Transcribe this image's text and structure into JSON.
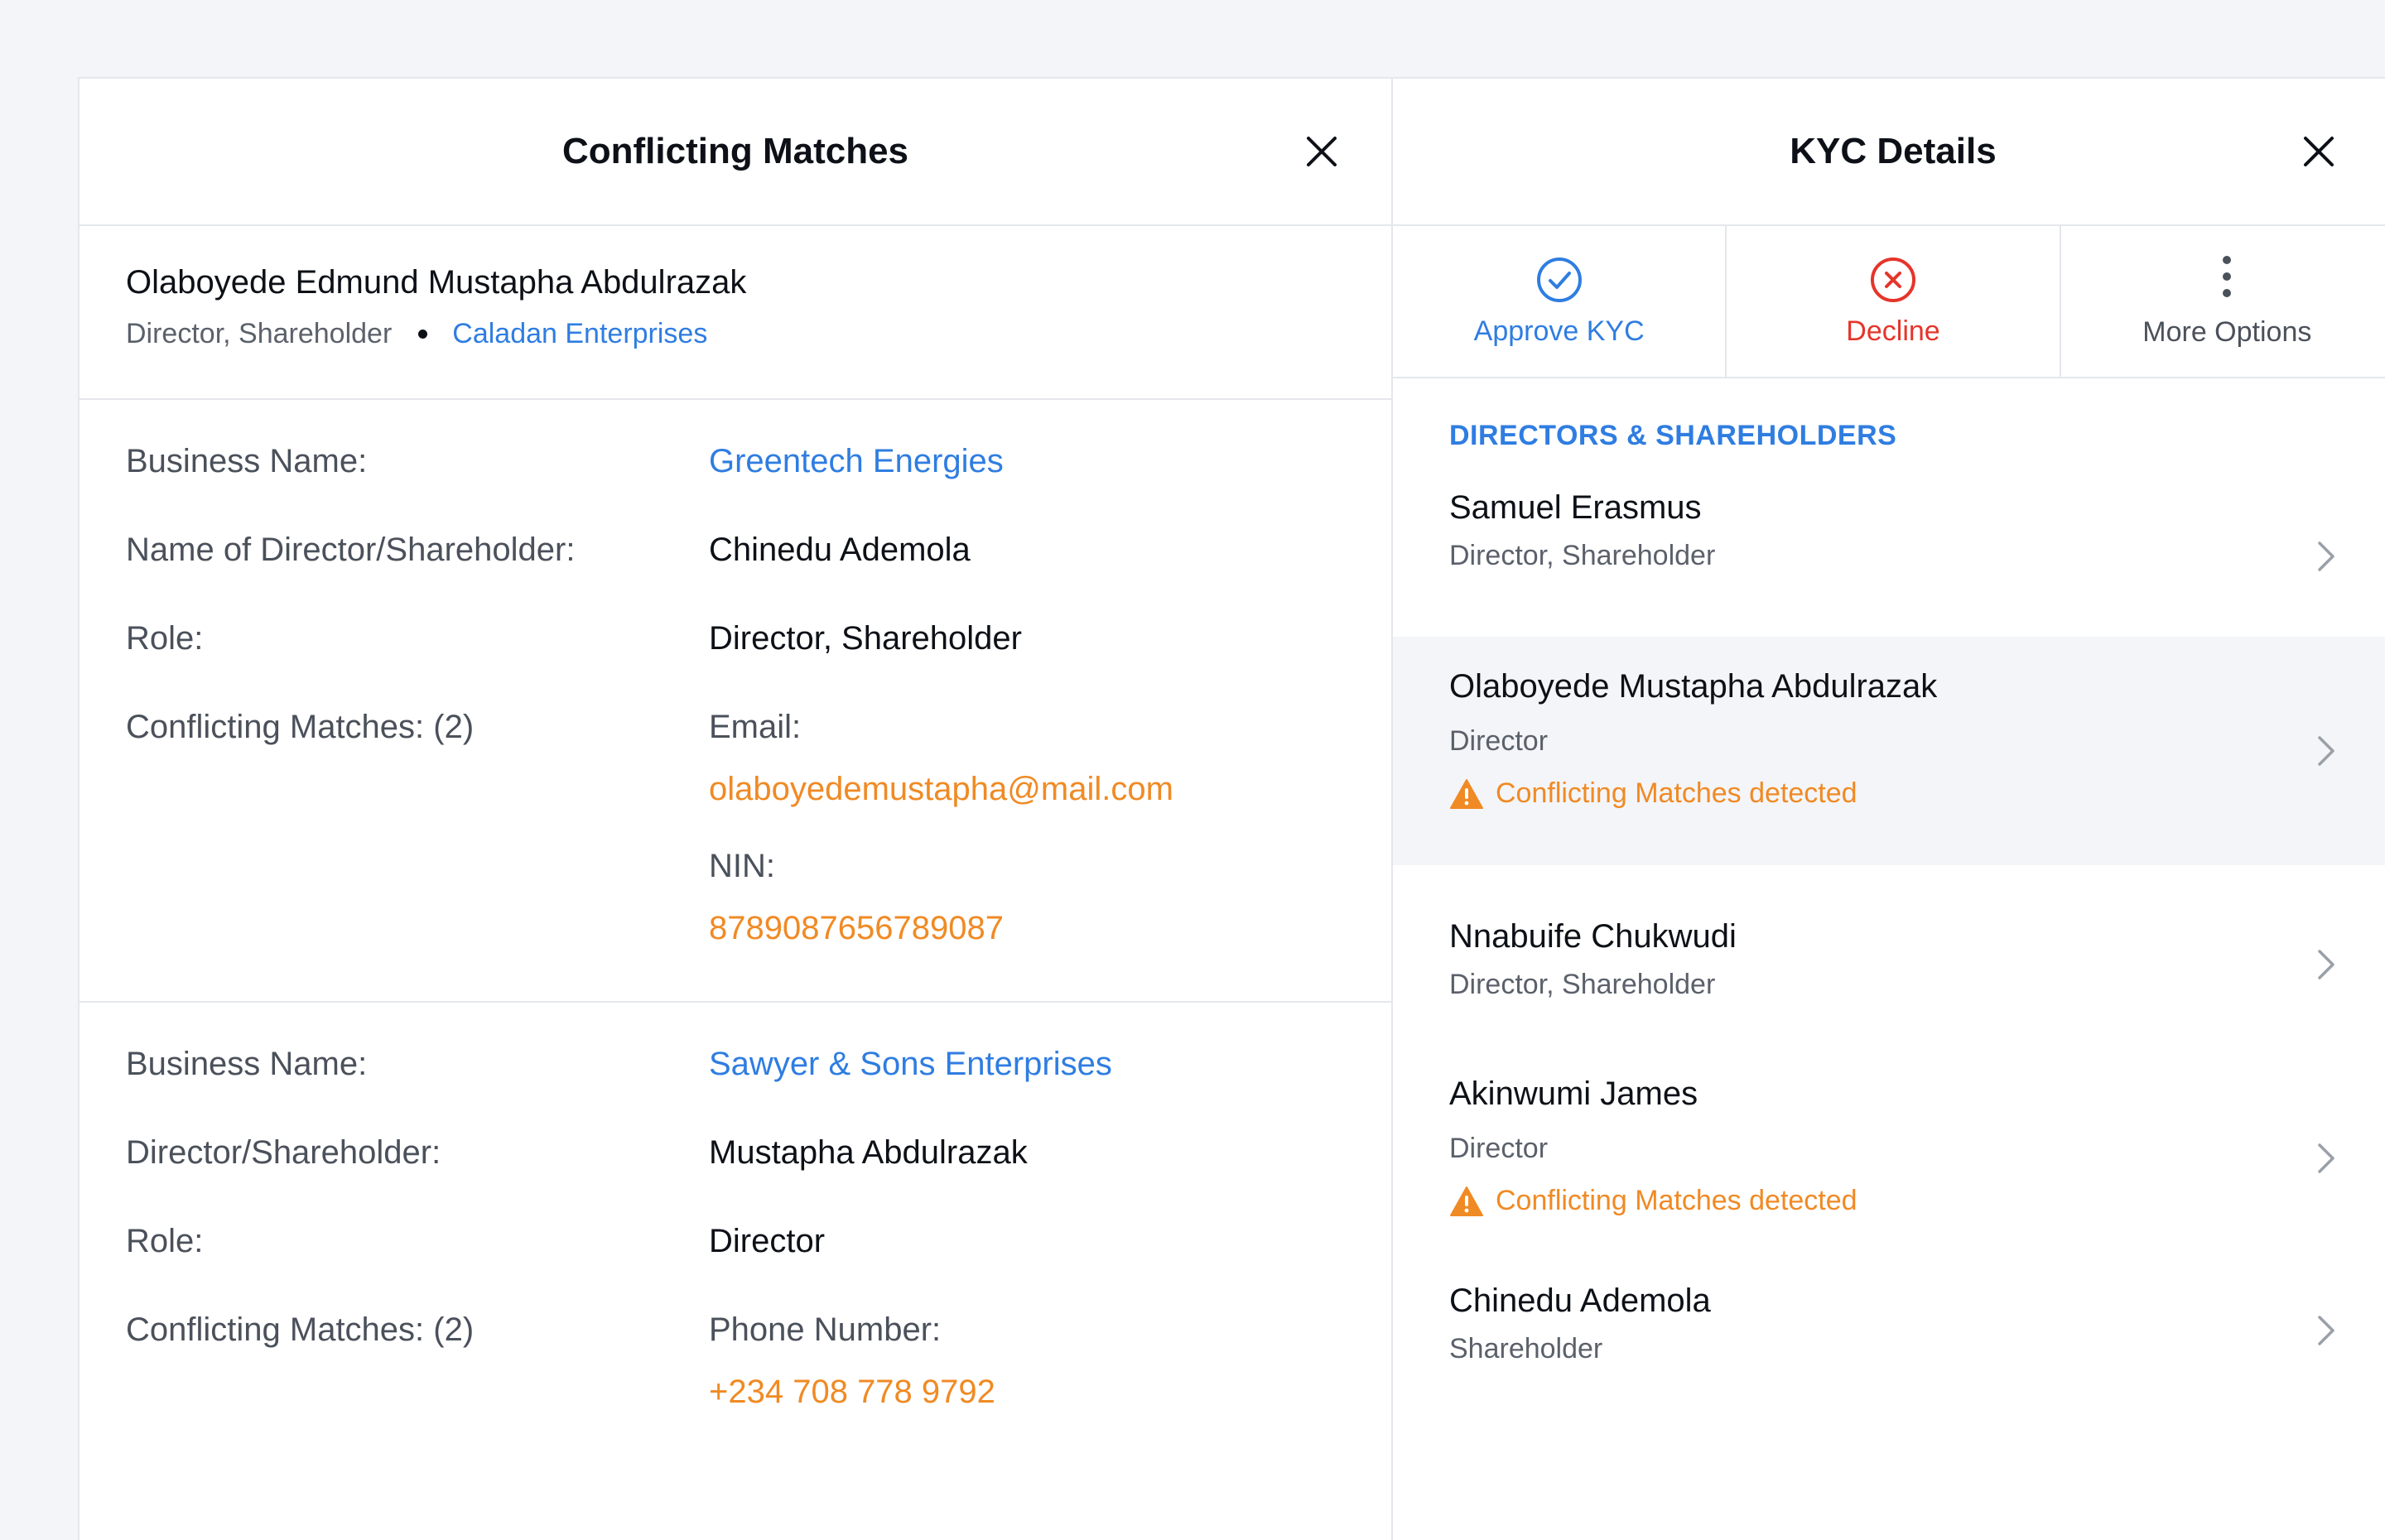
{
  "left_panel": {
    "title": "Conflicting Matches",
    "person": {
      "name": "Olaboyede Edmund Mustapha Abdulrazak",
      "role": "Director, Shareholder",
      "company": "Caladan Enterprises"
    },
    "matches": [
      {
        "business_label": "Business Name:",
        "business_value": "Greentech Energies",
        "director_label": "Name of Director/Shareholder:",
        "director_value": "Chinedu Ademola",
        "role_label": "Role:",
        "role_value": "Director, Shareholder",
        "conflicts_label": "Conflicting Matches: (2)",
        "fields": [
          {
            "label": "Email:",
            "value": "olaboyedemustapha@mail.com"
          },
          {
            "label": "NIN:",
            "value": "8789087656789087"
          }
        ]
      },
      {
        "business_label": "Business Name:",
        "business_value": "Sawyer & Sons Enterprises",
        "director_label": "Director/Shareholder:",
        "director_value": "Mustapha Abdulrazak",
        "role_label": "Role:",
        "role_value": "Director",
        "conflicts_label": "Conflicting Matches: (2)",
        "fields": [
          {
            "label": "Phone Number:",
            "value": "+234 708 778 9792"
          }
        ]
      }
    ]
  },
  "right_panel": {
    "title": "KYC Details",
    "actions": {
      "approve": "Approve KYC",
      "decline": "Decline",
      "more": "More Options"
    },
    "section_title": "DIRECTORS & SHAREHOLDERS",
    "warning_text": "Conflicting Matches detected",
    "people": [
      {
        "name": "Samuel Erasmus",
        "role": "Director, Shareholder"
      },
      {
        "name": "Olaboyede Mustapha Abdulrazak",
        "role": "Director"
      },
      {
        "name": "Nnabuife Chukwudi",
        "role": "Director, Shareholder"
      },
      {
        "name": "Akinwumi James",
        "role": "Director"
      },
      {
        "name": "Chinedu Ademola",
        "role": "Shareholder"
      }
    ]
  },
  "colors": {
    "accent_blue": "#2f7de1",
    "warning_orange": "#f08a24",
    "decline_red": "#e5352b",
    "border": "#e4e7ec"
  },
  "icons": {
    "close": "close-icon",
    "approve": "check-circle-icon",
    "decline": "x-circle-icon",
    "more": "vertical-dots-icon",
    "warning": "warning-triangle-icon",
    "chevron": "chevron-right-icon"
  }
}
